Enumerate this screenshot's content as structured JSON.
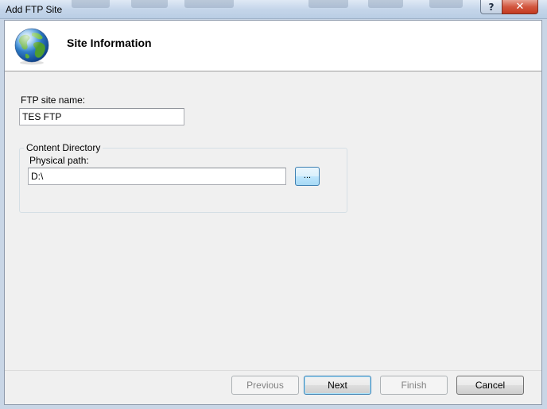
{
  "window": {
    "title": "Add FTP Site",
    "help_glyph": "?",
    "close_glyph": "✕"
  },
  "header": {
    "title": "Site Information",
    "icon": "globe-icon"
  },
  "form": {
    "site_name_label": "FTP site name:",
    "site_name_value": "TES FTP",
    "content_directory_legend": "Content Directory",
    "physical_path_label": "Physical path:",
    "physical_path_value": "D:\\",
    "browse_label": "..."
  },
  "footer": {
    "previous_label": "Previous",
    "next_label": "Next",
    "finish_label": "Finish",
    "cancel_label": "Cancel"
  },
  "colors": {
    "dialog_bg": "#f0f0f0",
    "header_bg": "#ffffff",
    "close_red": "#c43a20",
    "accent_blue": "#3c7fb1"
  }
}
